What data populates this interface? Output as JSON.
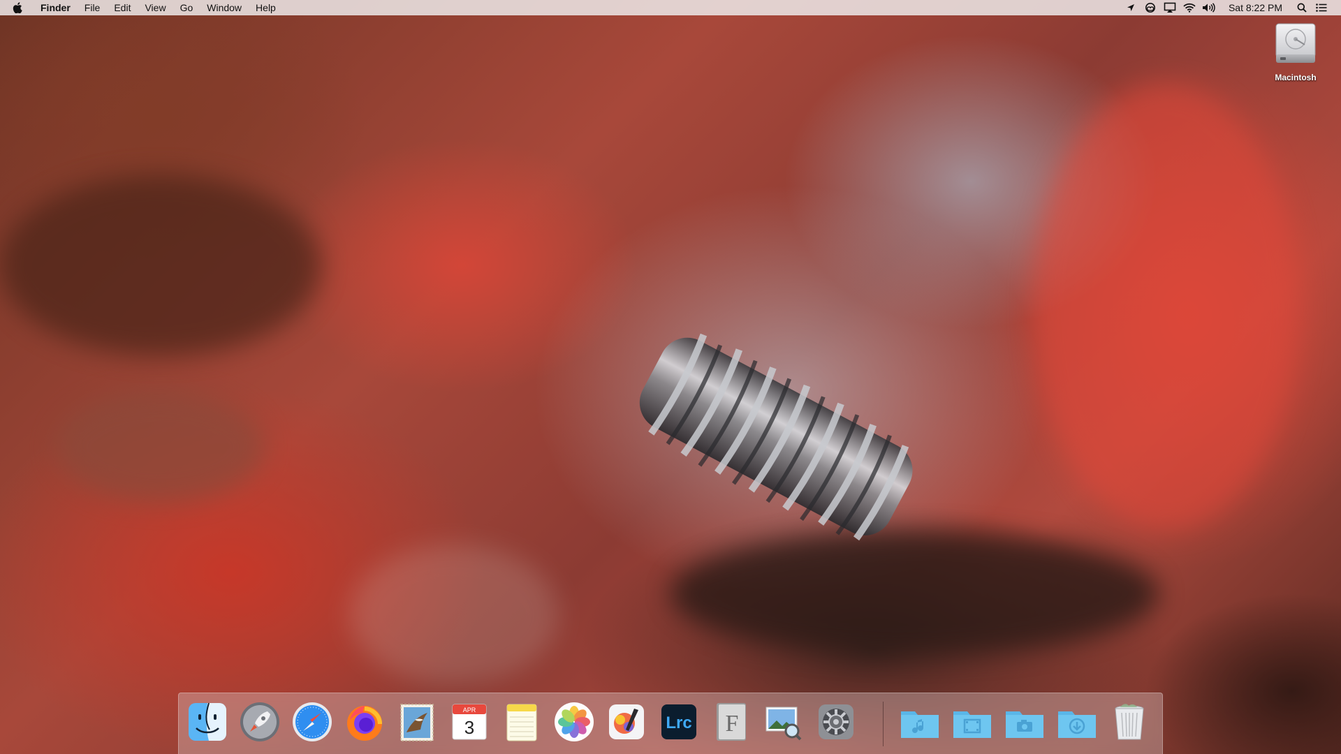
{
  "menubar": {
    "apple_icon": "apple-icon",
    "app_name": "Finder",
    "menus": [
      "File",
      "Edit",
      "View",
      "Go",
      "Window",
      "Help"
    ],
    "status_icons": [
      "location-arrow-icon",
      "creative-cloud-icon",
      "airplay-icon",
      "wifi-icon",
      "volume-icon"
    ],
    "clock": "Sat 8:22 PM",
    "right_icons": [
      "spotlight-search-icon",
      "notification-center-icon"
    ]
  },
  "desktop": {
    "icons": [
      {
        "label": "Macintosh",
        "icon": "hard-drive-icon"
      }
    ]
  },
  "dock": {
    "apps": [
      {
        "name": "Finder",
        "icon": "finder-icon",
        "running": true
      },
      {
        "name": "Launchpad",
        "icon": "launchpad-icon",
        "running": false
      },
      {
        "name": "Safari",
        "icon": "safari-icon",
        "running": true
      },
      {
        "name": "Firefox",
        "icon": "firefox-icon",
        "running": false
      },
      {
        "name": "Mail",
        "icon": "mail-icon",
        "running": false
      },
      {
        "name": "Calendar",
        "icon": "calendar-icon",
        "running": false,
        "month": "APR",
        "day": "3"
      },
      {
        "name": "Notes",
        "icon": "notes-icon",
        "running": false
      },
      {
        "name": "Photos",
        "icon": "photos-icon",
        "running": false
      },
      {
        "name": "Pixelmator",
        "icon": "pixelmator-icon",
        "running": false
      },
      {
        "name": "Lightroom Classic",
        "icon": "lightroom-classic-icon",
        "running": false,
        "text": "Lrc"
      },
      {
        "name": "Font Book",
        "icon": "font-book-icon",
        "running": false,
        "text": "F"
      },
      {
        "name": "Preview",
        "icon": "preview-icon",
        "running": false
      },
      {
        "name": "System Preferences",
        "icon": "system-preferences-icon",
        "running": false
      }
    ],
    "folders": [
      {
        "name": "Music",
        "icon": "music-folder-icon"
      },
      {
        "name": "Movies",
        "icon": "movies-folder-icon"
      },
      {
        "name": "Pictures",
        "icon": "pictures-folder-icon"
      },
      {
        "name": "Downloads",
        "icon": "downloads-folder-icon"
      },
      {
        "name": "Trash",
        "icon": "trash-icon"
      }
    ]
  },
  "colors": {
    "menubar_bg": "#ece8e8",
    "folder_blue": "#6ec6f0",
    "wallpaper_red": "#b14a3e"
  }
}
